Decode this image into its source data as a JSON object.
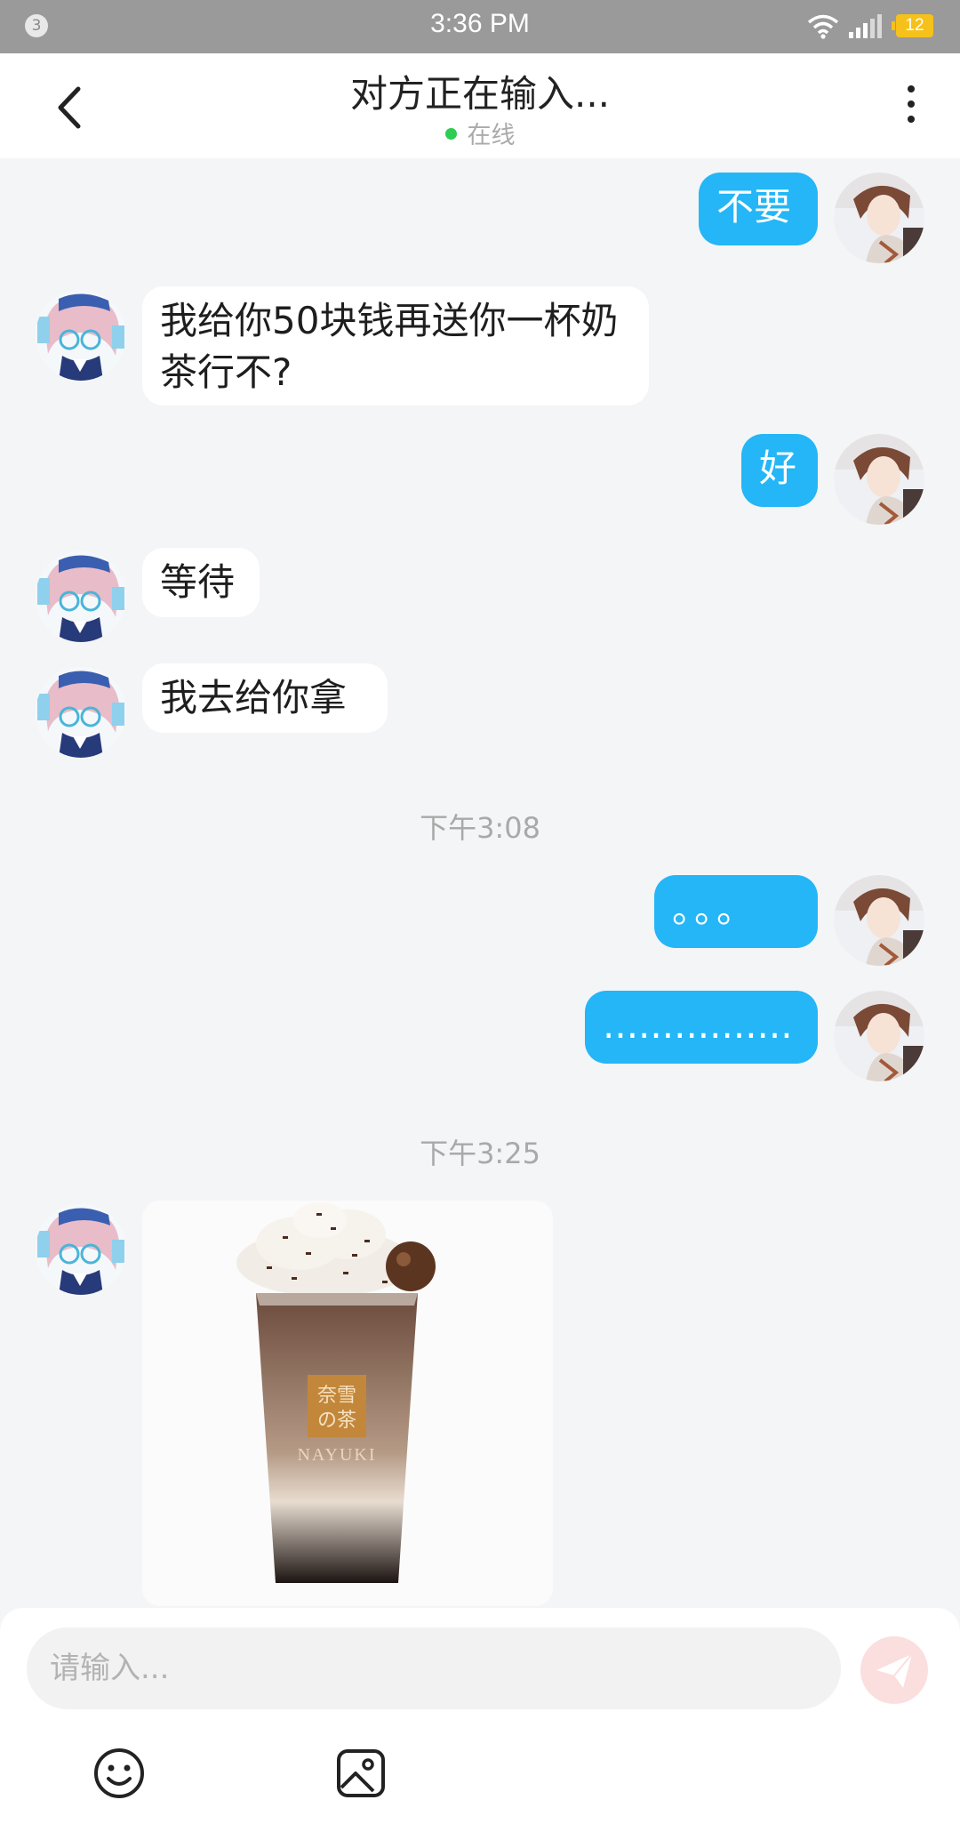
{
  "status_bar": {
    "notification_count": "3",
    "time": "3:36 PM",
    "battery": "12"
  },
  "header": {
    "title": "对方正在输入...",
    "status": "在线"
  },
  "messages": [
    {
      "text": "不要"
    },
    {
      "text": "我给你50块钱再送你一杯奶茶行不?"
    },
    {
      "text": "好"
    },
    {
      "text": "等待"
    },
    {
      "text": "我去给你拿"
    },
    {
      "text": "。。。"
    },
    {
      "text": "................"
    }
  ],
  "timestamps": [
    "下午3:08",
    "下午3:25"
  ],
  "image_message": {
    "watermark_top": "奈雪",
    "watermark_bottom": "の茶",
    "brand": "NAYUKI"
  },
  "input": {
    "placeholder": "请输入..."
  },
  "colors": {
    "accent": "#24b6f6",
    "online": "#2ecc52",
    "send_disabled": "#fbdede"
  }
}
